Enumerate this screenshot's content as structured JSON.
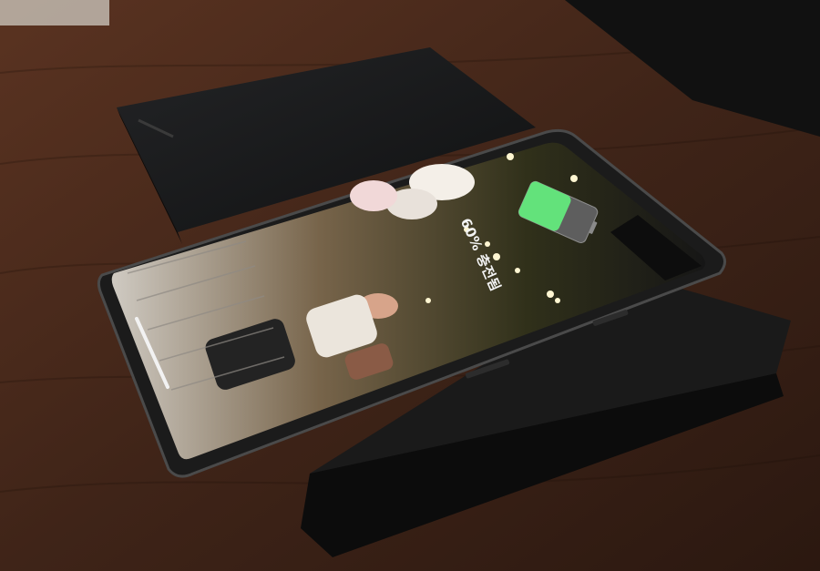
{
  "photo": {
    "subject": "smartphone-on-wireless-charger",
    "charging_status_text": "60% 충전됨",
    "battery_level_percent": 60,
    "colors": {
      "table": "#4a2a1c",
      "charger": "#141414",
      "phone_frame": "#1b1b1b",
      "battery_fill": "#63e27b"
    }
  }
}
